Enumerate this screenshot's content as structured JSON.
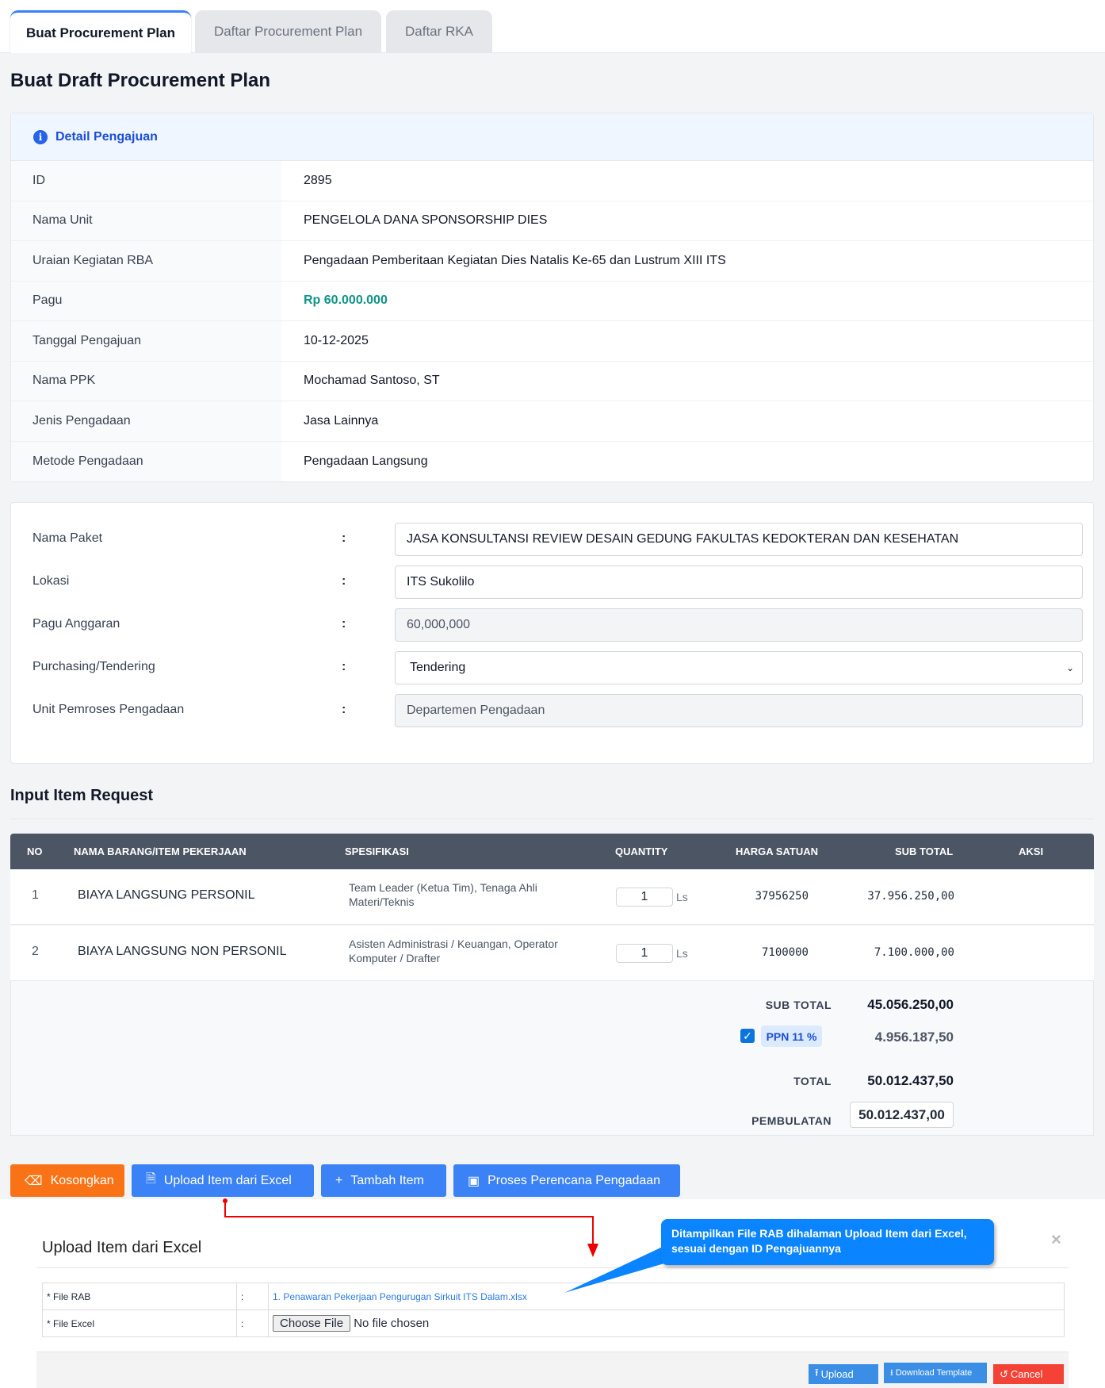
{
  "tabs": [
    "Buat Procurement Plan",
    "Daftar Procurement Plan",
    "Daftar RKA"
  ],
  "page_title": "Buat Draft Procurement Plan",
  "detail": {
    "header": "Detail Pengajuan",
    "rows": [
      {
        "label": "ID",
        "value": "2895"
      },
      {
        "label": "Nama Unit",
        "value": "PENGELOLA DANA SPONSORSHIP DIES"
      },
      {
        "label": "Uraian Kegiatan RBA",
        "value": "Pengadaan Pemberitaan Kegiatan Dies Natalis Ke-65 dan Lustrum XIII ITS"
      },
      {
        "label": "Pagu",
        "value": "Rp 60.000.000"
      },
      {
        "label": "Tanggal Pengajuan",
        "value": "10-12-2025"
      },
      {
        "label": "Nama PPK",
        "value": "Mochamad Santoso, ST"
      },
      {
        "label": "Jenis Pengadaan",
        "value": "Jasa Lainnya"
      },
      {
        "label": "Metode Pengadaan",
        "value": "Pengadaan Langsung"
      }
    ]
  },
  "form": {
    "colon": ":",
    "fields": [
      {
        "label": "Nama Paket",
        "value": "JASA KONSULTANSI REVIEW DESAIN GEDUNG FAKULTAS KEDOKTERAN DAN KESEHATAN"
      },
      {
        "label": "Lokasi",
        "value": "ITS Sukolilo"
      },
      {
        "label": "Pagu Anggaran",
        "value": "60,000,000"
      },
      {
        "label": "Purchasing/Tendering",
        "value": "Tendering"
      },
      {
        "label": "Unit Pemroses Pengadaan",
        "value": "Departemen Pengadaan"
      }
    ]
  },
  "items": {
    "title": "Input Item Request",
    "headers": [
      "NO",
      "NAMA BARANG/ITEM PEKERJAAN",
      "SPESIFIKASI",
      "QUANTITY",
      "HARGA SATUAN",
      "SUB TOTAL",
      "AKSI"
    ],
    "rows": [
      {
        "no": "1",
        "name": "BIAYA LANGSUNG PERSONIL",
        "spec": "Team Leader (Ketua Tim), Tenaga Ahli Materi/Teknis",
        "qty": "1",
        "unit": "Ls",
        "price": "37956250",
        "subtotal": "37.956.250,00"
      },
      {
        "no": "2",
        "name": "BIAYA LANGSUNG NON PERSONIL",
        "spec": "Asisten Administrasi / Keuangan, Operator Komputer / Drafter",
        "qty": "1",
        "unit": "Ls",
        "price": "7100000",
        "subtotal": "7.100.000,00"
      }
    ],
    "totals": {
      "subtotal_label": "SUB TOTAL",
      "subtotal": "45.056.250,00",
      "ppn_label": "PPN 11 %",
      "ppn": "4.956.187,50",
      "total_label": "TOTAL",
      "total": "50.012.437,50",
      "rounding_label": "PEMBULATAN",
      "rounding": "50.012.437,00"
    }
  },
  "buttons": {
    "clear": "Kosongkan",
    "upload": "Upload Item dari Excel",
    "add": "Tambah Item",
    "process": "Proses Perencana Pengadaan"
  },
  "modal": {
    "title": "Upload Item dari Excel",
    "close": "×",
    "file_rab_label": "* File RAB",
    "file_rab": "1. Penawaran Pekerjaan Pengurugan Sirkuit ITS Dalam.xlsx",
    "file_excel_label": "* File Excel",
    "colon": ":",
    "choose": "Choose File",
    "no_file": "No file chosen",
    "upload": "Upload",
    "download": "Download Template",
    "cancel": "Cancel"
  },
  "callout": "Ditampilkan File RAB dihalaman Upload Item dari Excel, sesuai dengan ID Pengajuannya",
  "colors": {
    "accent": "#3b82f6",
    "orange": "#f97316",
    "green": "#0d9488",
    "cancel": "#f44336"
  }
}
